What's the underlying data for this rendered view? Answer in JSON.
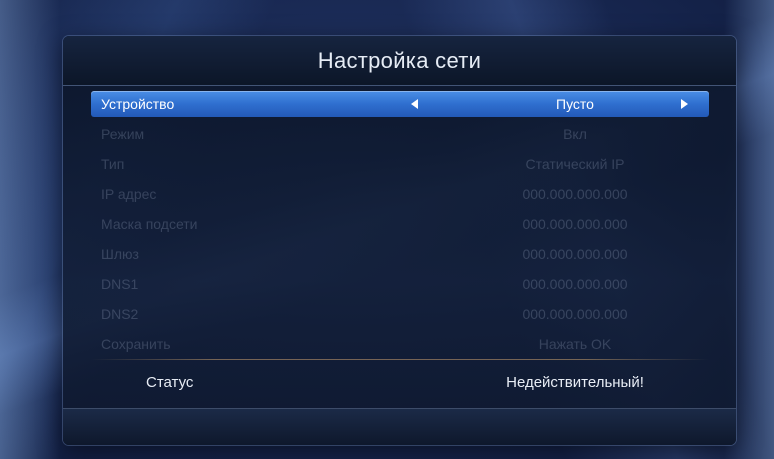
{
  "dialog": {
    "title": "Настройка сети"
  },
  "settings": [
    {
      "label": "Устройство",
      "value": "Пусто",
      "selected": true
    },
    {
      "label": "Режим",
      "value": "Вкл"
    },
    {
      "label": "Тип",
      "value": "Статический IP"
    },
    {
      "label": "IP адрес",
      "value": "000.000.000.000"
    },
    {
      "label": "Маска подсети",
      "value": "000.000.000.000"
    },
    {
      "label": "Шлюз",
      "value": "000.000.000.000"
    },
    {
      "label": "DNS1",
      "value": "000.000.000.000"
    },
    {
      "label": "DNS2",
      "value": "000.000.000.000"
    },
    {
      "label": "Сохранить",
      "value": "Нажать OK"
    }
  ],
  "status": {
    "label": "Статус",
    "value": "Недействительный!"
  },
  "colors": {
    "selection": "#3a7ddb",
    "background": "#1a2a55",
    "panel": "#0e1a33"
  }
}
